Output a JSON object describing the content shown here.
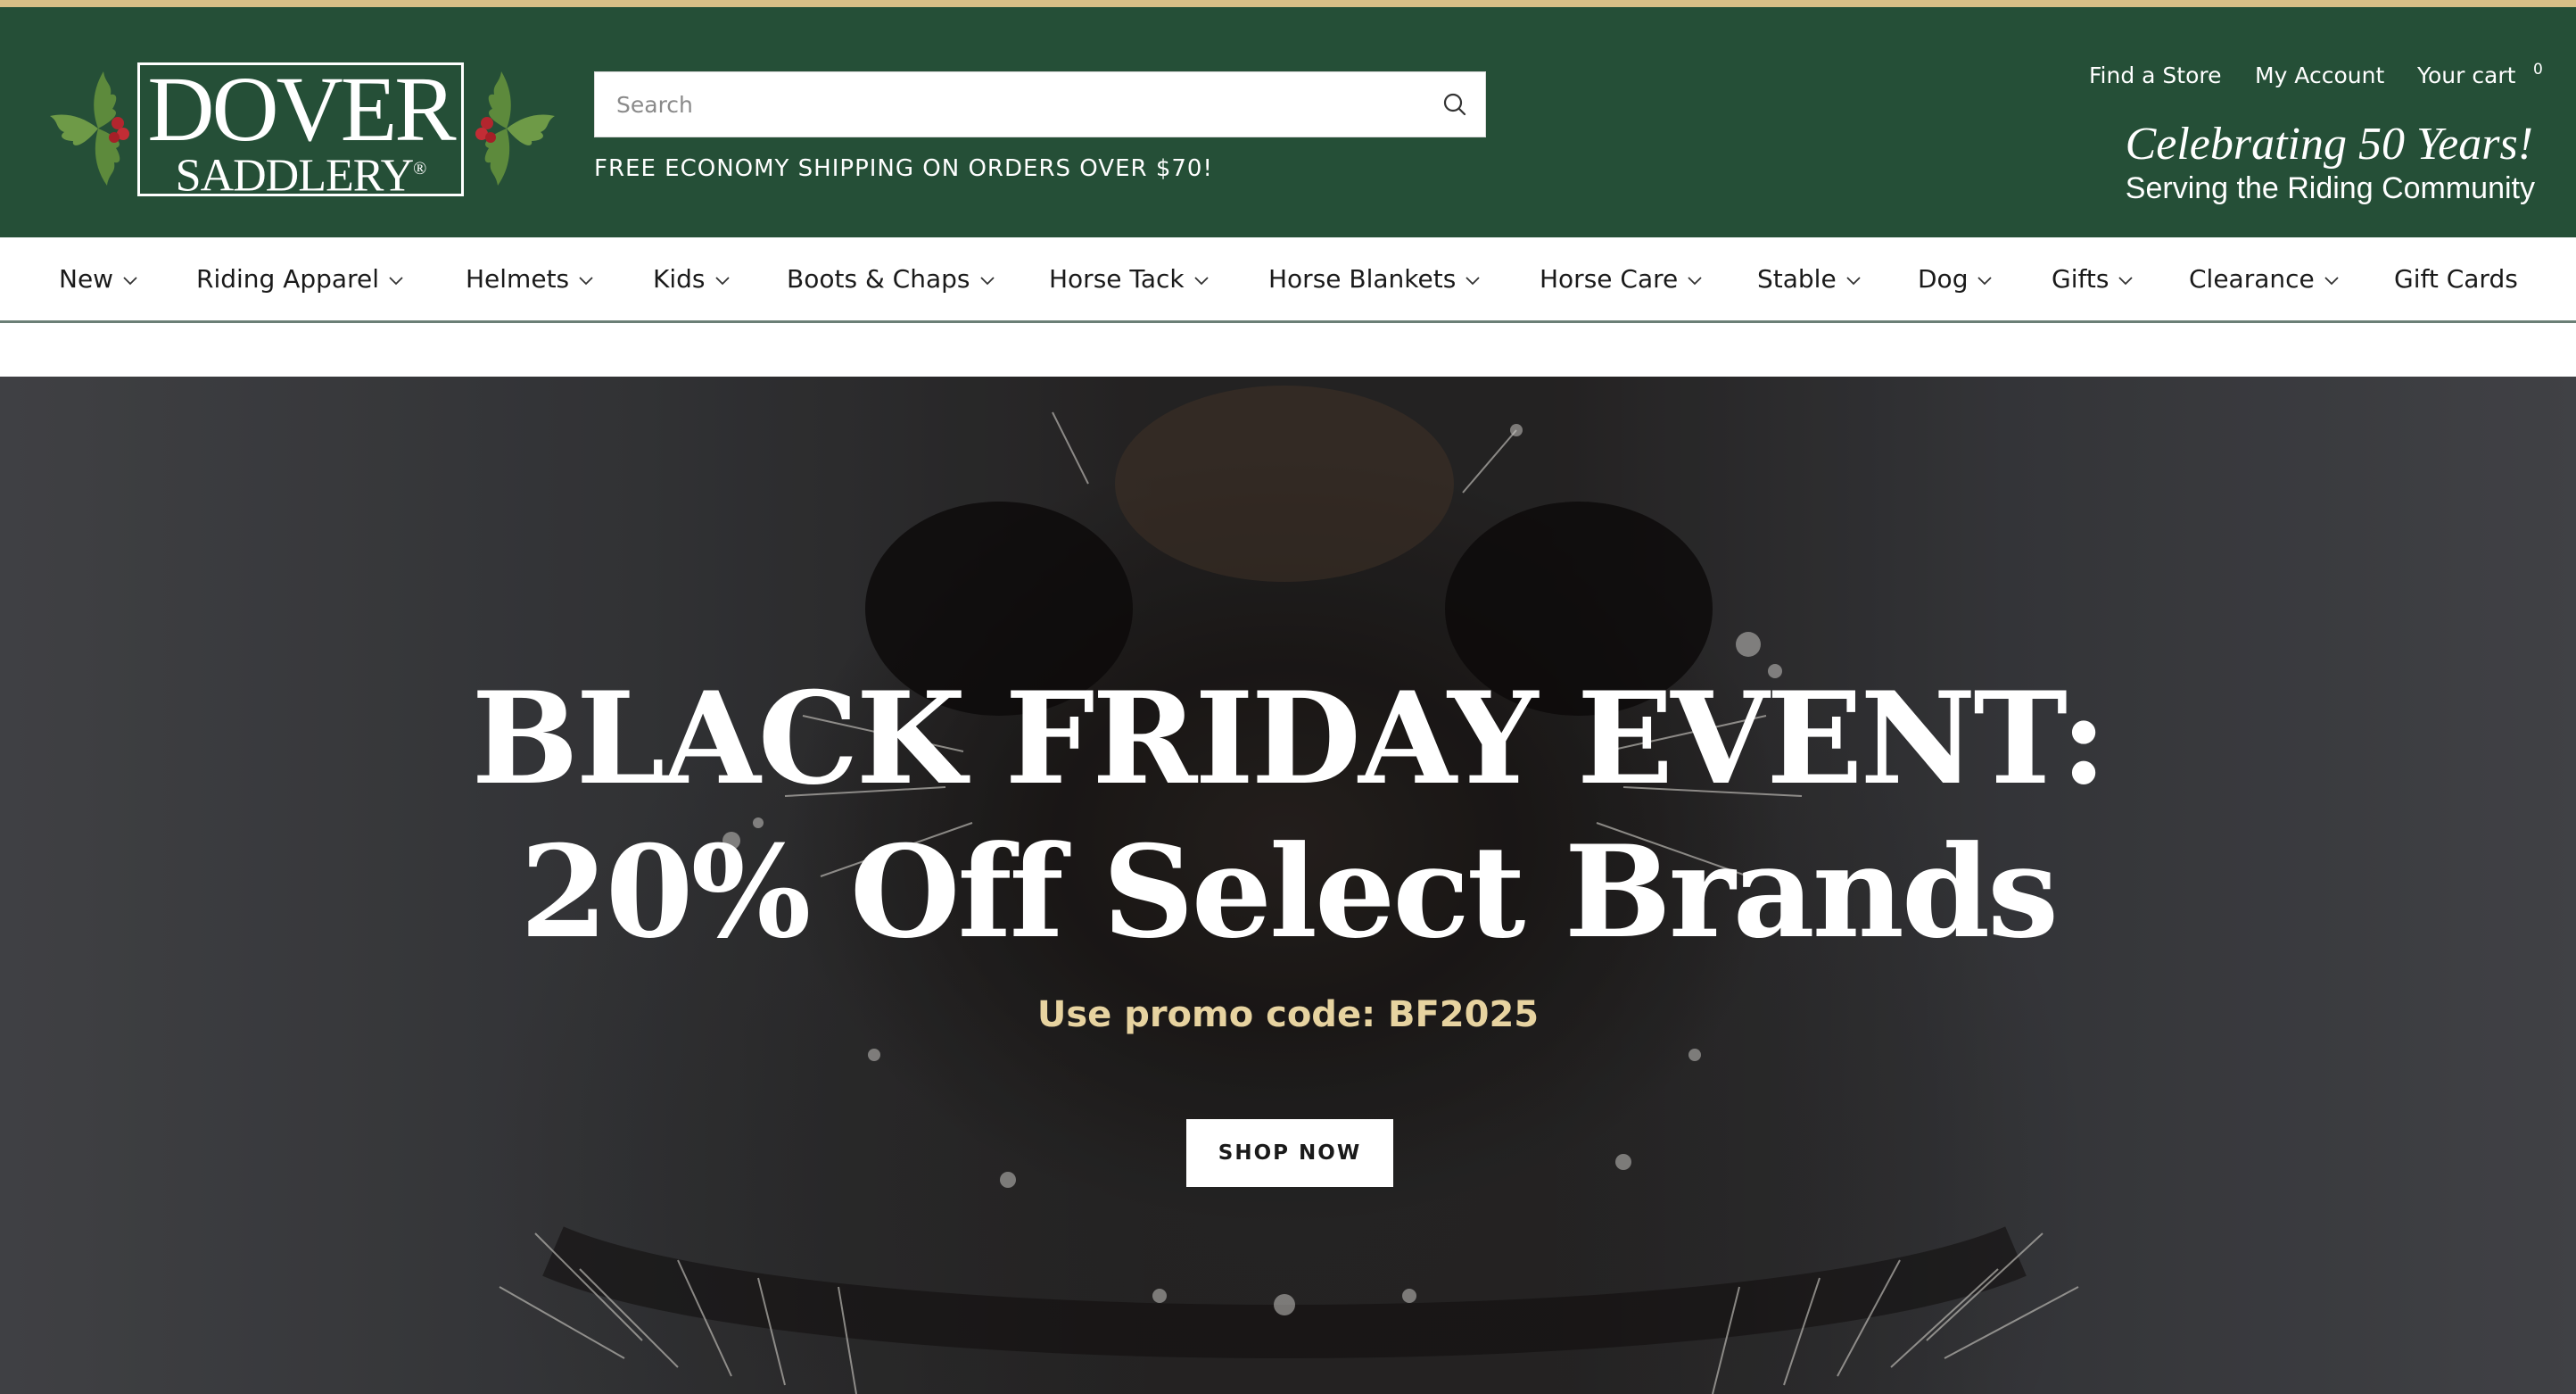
{
  "brand": {
    "logo_line1": "DOVER",
    "logo_line2": "SADDLERY",
    "registered_mark": "®",
    "colors": {
      "header_green": "#254f37",
      "accent_gold": "#d8bf86",
      "promo_gold": "#e7d3a0"
    }
  },
  "search": {
    "placeholder": "Search",
    "value": "",
    "icon": "search-icon"
  },
  "shipping_notice": "FREE ECONOMY SHIPPING ON ORDERS OVER $70!",
  "utility": {
    "find_store": "Find a Store",
    "my_account": "My Account",
    "cart_label": "Your cart",
    "cart_count": "0"
  },
  "tagline": {
    "celebrating": "Celebrating 50 Years!",
    "serving": "Serving the Riding Community"
  },
  "nav": {
    "items": [
      {
        "label": "New",
        "has_dropdown": true
      },
      {
        "label": "Riding Apparel",
        "has_dropdown": true
      },
      {
        "label": "Helmets",
        "has_dropdown": true
      },
      {
        "label": "Kids",
        "has_dropdown": true
      },
      {
        "label": "Boots & Chaps",
        "has_dropdown": true
      },
      {
        "label": "Horse Tack",
        "has_dropdown": true
      },
      {
        "label": "Horse Blankets",
        "has_dropdown": true
      },
      {
        "label": "Horse Care",
        "has_dropdown": true
      },
      {
        "label": "Stable",
        "has_dropdown": true
      },
      {
        "label": "Dog",
        "has_dropdown": true
      },
      {
        "label": "Gifts",
        "has_dropdown": true
      },
      {
        "label": "Clearance",
        "has_dropdown": true
      },
      {
        "label": "Gift Cards",
        "has_dropdown": false
      }
    ]
  },
  "hero": {
    "title_line1": "BLACK FRIDAY EVENT:",
    "title_line2": "20% Off Select Brands",
    "promo": "Use promo code: BF2025",
    "cta": "SHOP NOW"
  }
}
